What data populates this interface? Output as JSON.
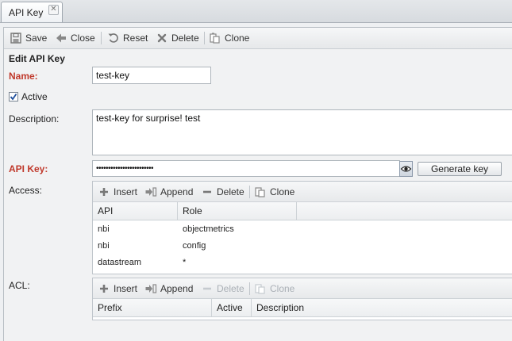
{
  "tab": {
    "label": "API Key",
    "close": "✕"
  },
  "toolbar": {
    "save": "Save",
    "close": "Close",
    "reset": "Reset",
    "delete": "Delete",
    "clone": "Clone"
  },
  "form": {
    "title": "Edit API Key",
    "name_label": "Name:",
    "name_value": "test-key",
    "active_label": "Active",
    "active_checked": true,
    "description_label": "Description:",
    "description_value": "test-key for surprise! test",
    "apikey_label": "API Key:",
    "apikey_value": "••••••••••••••••••••••••",
    "generate_label": "Generate key",
    "access_label": "Access:",
    "acl_label": "ACL:"
  },
  "access_grid": {
    "toolbar": {
      "insert": "Insert",
      "append": "Append",
      "delete": "Delete",
      "clone": "Clone"
    },
    "columns": [
      "API",
      "Role"
    ],
    "rows": [
      [
        "nbi",
        "objectmetrics"
      ],
      [
        "nbi",
        "config"
      ],
      [
        "datastream",
        "*"
      ]
    ]
  },
  "acl_grid": {
    "toolbar": {
      "insert": "Insert",
      "append": "Append",
      "delete": "Delete",
      "clone": "Clone"
    },
    "columns": [
      "Prefix",
      "Active",
      "Description"
    ]
  }
}
